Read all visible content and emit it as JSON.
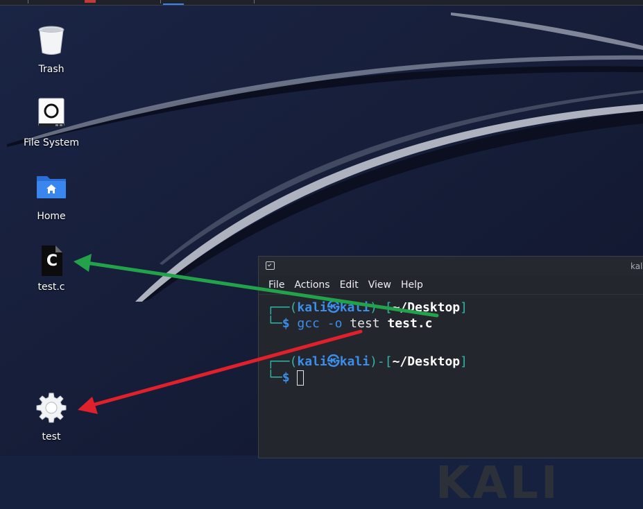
{
  "desktop": {
    "icons": [
      {
        "name": "trash",
        "label": "Trash"
      },
      {
        "name": "file-system",
        "label": "File System"
      },
      {
        "name": "home",
        "label": "Home"
      },
      {
        "name": "test-c",
        "label": "test.c",
        "glyph_text": "C"
      },
      {
        "name": "test",
        "label": "test"
      }
    ]
  },
  "terminal": {
    "title": "kali",
    "menu": [
      "File",
      "Actions",
      "Edit",
      "View",
      "Help"
    ],
    "prompt": {
      "user": "kali",
      "at": "㉿",
      "host": "kali",
      "path": "~/Desktop",
      "symbol": "$"
    },
    "command": {
      "program": "gcc",
      "flag": "-o",
      "output": "test",
      "source": "test.c"
    }
  },
  "annotations": {
    "green_arrow_color": "#22a34a",
    "red_arrow_color": "#e0202a"
  },
  "colors": {
    "wallpaper": "#16213f",
    "terminal_bg": "#23262d",
    "prompt_teal": "#2fb6a8",
    "prompt_blue": "#3b8eea"
  }
}
